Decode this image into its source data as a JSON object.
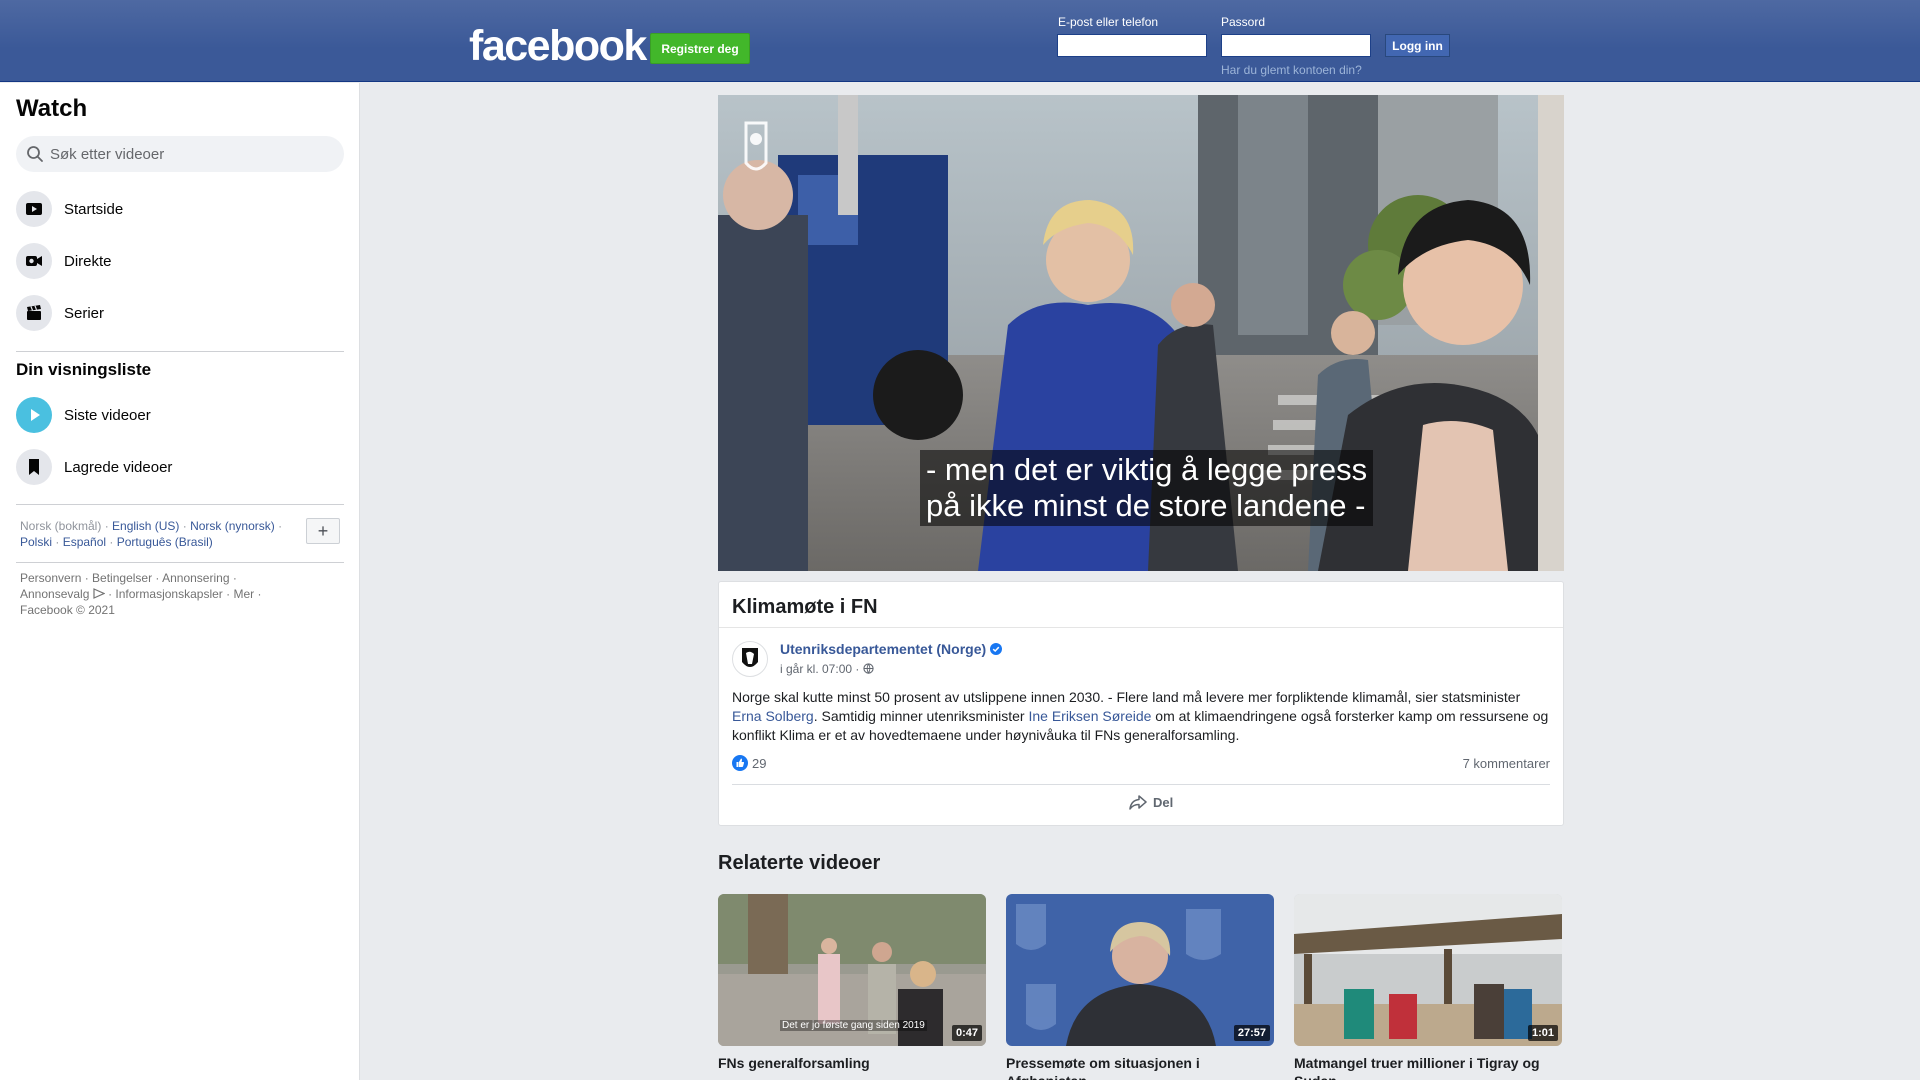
{
  "header": {
    "logo": "facebook",
    "register_label": "Registrer deg",
    "email_label": "E-post eller telefon",
    "password_label": "Passord",
    "login_label": "Logg inn",
    "forgot_label": "Har du glemt kontoen din?"
  },
  "sidebar": {
    "title": "Watch",
    "search_placeholder": "Søk etter videoer",
    "nav": [
      {
        "label": "Startside",
        "icon": "play-screen-icon"
      },
      {
        "label": "Direkte",
        "icon": "live-camera-icon"
      },
      {
        "label": "Serier",
        "icon": "clapperboard-icon"
      }
    ],
    "watchlist_title": "Din visningsliste",
    "watchlist": [
      {
        "label": "Siste videoer",
        "icon": "play-circle-icon"
      },
      {
        "label": "Lagrede videoer",
        "icon": "bookmark-icon"
      }
    ],
    "languages": {
      "current": "Norsk (bokmål)",
      "others": [
        "English (US)",
        "Norsk (nynorsk)",
        "Polski",
        "Español",
        "Português (Brasil)"
      ]
    },
    "add_language": "+",
    "footer": {
      "links": [
        "Personvern",
        "Betingelser",
        "Annonsering",
        "Annonsevalg",
        "Informasjonskapsler",
        "Mer"
      ],
      "copyright": "Facebook © 2021"
    }
  },
  "video": {
    "caption_line1": "- men det er viktig å legge press",
    "caption_line2": "på ikke minst de store landene -"
  },
  "post": {
    "title": "Klimamøte i FN",
    "author": "Utenriksdepartementet (Norge)",
    "time": "i går kl. 07:00 ·",
    "text_part1": "Norge skal kutte minst 50 prosent av utslippene innen 2030. - Flere land må levere mer forpliktende klimamål, sier statsminister ",
    "mention1": "Erna Solberg",
    "text_part2": ". Samtidig minner utenriksminister ",
    "mention2": "Ine Eriksen Søreide",
    "text_part3": " om at klimaendringene også forsterker kamp om ressursene og konflikt Klima er et av hovedtemaene under høynivåuka til FNs generalforsamling.",
    "likes": "29",
    "comments": "7 kommentarer",
    "share_label": "Del"
  },
  "related": {
    "title": "Relaterte videoer",
    "items": [
      {
        "title": "FNs generalforsamling",
        "duration": "0:47",
        "subtitle": "Det er jo første gang siden 2019"
      },
      {
        "title": "Pressemøte om situasjonen i Afghanistan",
        "duration": "27:57",
        "subtitle": ""
      },
      {
        "title": "Matmangel truer millioner i Tigray og Sudan",
        "duration": "1:01",
        "subtitle": ""
      }
    ]
  },
  "colors": {
    "header_blue": "#3b5998",
    "register_green": "#42b72a",
    "link_blue": "#385898"
  }
}
